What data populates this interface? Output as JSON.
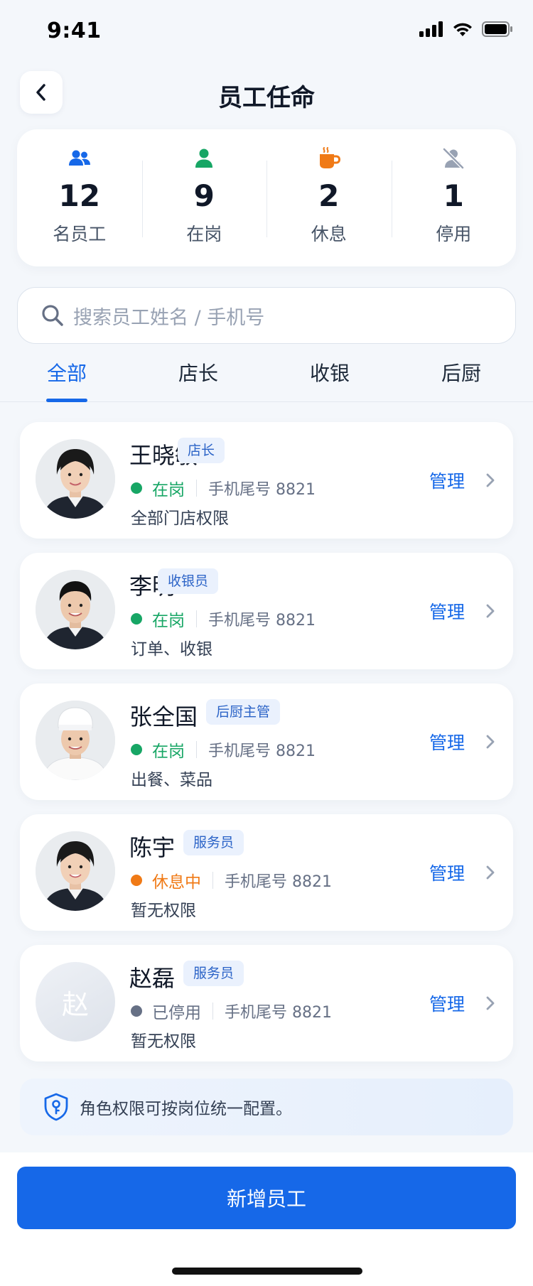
{
  "status_bar": {
    "time": "9:41"
  },
  "header": {
    "title": "员工任命"
  },
  "stats": [
    {
      "icon": "users-icon",
      "value": "12",
      "label": "名员工",
      "color": "#1668E8"
    },
    {
      "icon": "user-icon",
      "value": "9",
      "label": "在岗",
      "color": "#17A665"
    },
    {
      "icon": "coffee-icon",
      "value": "2",
      "label": "休息",
      "color": "#F07A16"
    },
    {
      "icon": "user-off-icon",
      "value": "1",
      "label": "停用",
      "color": "#98A2B3"
    }
  ],
  "search": {
    "placeholder": "搜索员工姓名 / 手机号"
  },
  "tabs": [
    "全部",
    "店长",
    "收银",
    "后厨"
  ],
  "active_tab": "全部",
  "employees": [
    {
      "name": "王晓敏",
      "role": "店长",
      "status": "在岗",
      "status_color": "#17A665",
      "phone": "手机尾号 8821",
      "permissions": "全部门店权限",
      "action": "管理",
      "avatar": "woman"
    },
    {
      "name": "李明",
      "role": "收银员",
      "status": "在岗",
      "status_color": "#17A665",
      "phone": "手机尾号 8821",
      "permissions": "订单、收银",
      "action": "管理",
      "avatar": "man"
    },
    {
      "name": "张全国",
      "role": "后厨主管",
      "status": "在岗",
      "status_color": "#17A665",
      "phone": "手机尾号 8821",
      "permissions": "出餐、菜品",
      "action": "管理",
      "avatar": "chef"
    },
    {
      "name": "陈宇",
      "role": "服务员",
      "status": "休息中",
      "status_color": "#F07A16",
      "phone": "手机尾号 8821",
      "permissions": "暂无权限",
      "action": "管理",
      "avatar": "woman"
    },
    {
      "name": "赵磊",
      "role": "服务员",
      "status": "已停用",
      "status_color": "#667085",
      "phone": "手机尾号 8821",
      "permissions": "暂无权限",
      "action": "管理",
      "avatar": "letter",
      "avatar_letter": "赵"
    }
  ],
  "tip": {
    "icon": "shield-key-icon",
    "text": "角色权限可按岗位统一配置。"
  },
  "primary_button": {
    "label": "新增员工"
  }
}
